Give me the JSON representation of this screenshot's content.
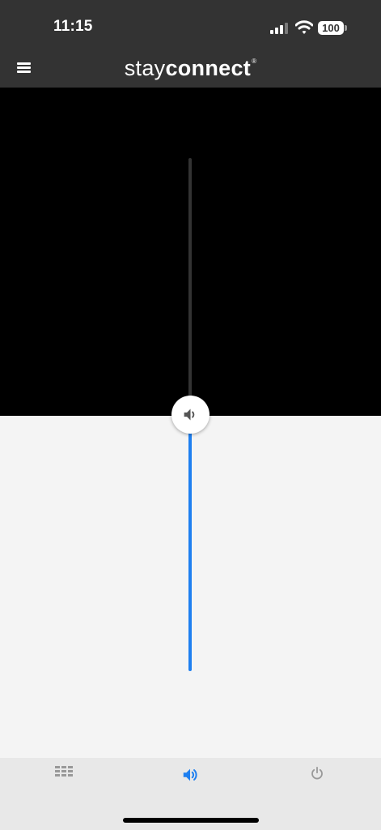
{
  "status_bar": {
    "time": "11:15",
    "battery": "100",
    "icons": [
      "signal-icon",
      "wifi-icon",
      "battery-icon"
    ]
  },
  "header": {
    "brand_part1": "stay",
    "brand_part2": "connect",
    "brand_mark": "®",
    "menu_icon": "hamburger-menu-icon"
  },
  "volume": {
    "level": 0.5,
    "thumb_icon": "speaker-icon",
    "active_color": "#1e7ff0",
    "inactive_color": "#333333"
  },
  "tabs": [
    {
      "icon": "keypad-grid-icon",
      "active": false
    },
    {
      "icon": "volume-icon",
      "active": true
    },
    {
      "icon": "power-icon",
      "active": false
    }
  ],
  "colors": {
    "header_bg": "#333333",
    "accent": "#1e7ff0",
    "tab_inactive": "#999999"
  }
}
